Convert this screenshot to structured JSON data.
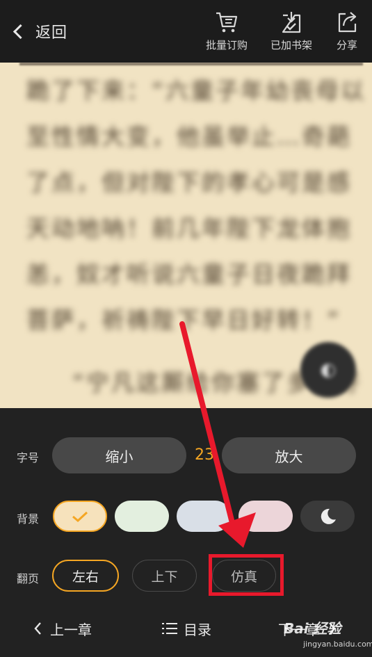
{
  "topbar": {
    "back_label": "返回",
    "tools": [
      {
        "label": "批量订购",
        "icon": "cart-icon"
      },
      {
        "label": "已加书架",
        "icon": "bookshelf-check-icon"
      },
      {
        "label": "分享",
        "icon": "share-icon"
      }
    ]
  },
  "reader": {
    "lines": [
      "跪了下来：“六童子年幼丧母以",
      "至性情大变，他虽举止…奇葩",
      "了点，但对陛下的孝心可是感",
      "天动地呐！前几年陛下龙体抱",
      "恙，奴才听说六童子日夜跪拜",
      "菩萨，祈祷陛下早日好转！”"
    ],
    "last_line": "“宁凡这厮给你塞了多少好"
  },
  "settings": {
    "font_size_label": "字号",
    "shrink_label": "缩小",
    "font_size_value": "23",
    "enlarge_label": "放大",
    "background_label": "背景",
    "backgrounds": [
      {
        "color": "#f6e2bc",
        "selected": true
      },
      {
        "color": "#e3efdf",
        "selected": false
      },
      {
        "color": "#d9dfe7",
        "selected": false
      },
      {
        "color": "#ecd5d9",
        "selected": false
      },
      {
        "color": "#3a3a3a",
        "selected": false
      }
    ],
    "accent_color": "#f5a623",
    "page_turn_label": "翻页",
    "page_turn_modes": [
      {
        "label": "左右",
        "selected": true
      },
      {
        "label": "上下",
        "selected": false
      },
      {
        "label": "仿真",
        "selected": false
      }
    ]
  },
  "bottom_nav": {
    "prev_label": "上一章",
    "toc_label": "目录",
    "next_label": "下一章"
  },
  "annotation": {
    "color": "#e8192c"
  },
  "watermark": {
    "text": "Bai 经验",
    "sub": "jingyan.baidu.com"
  }
}
